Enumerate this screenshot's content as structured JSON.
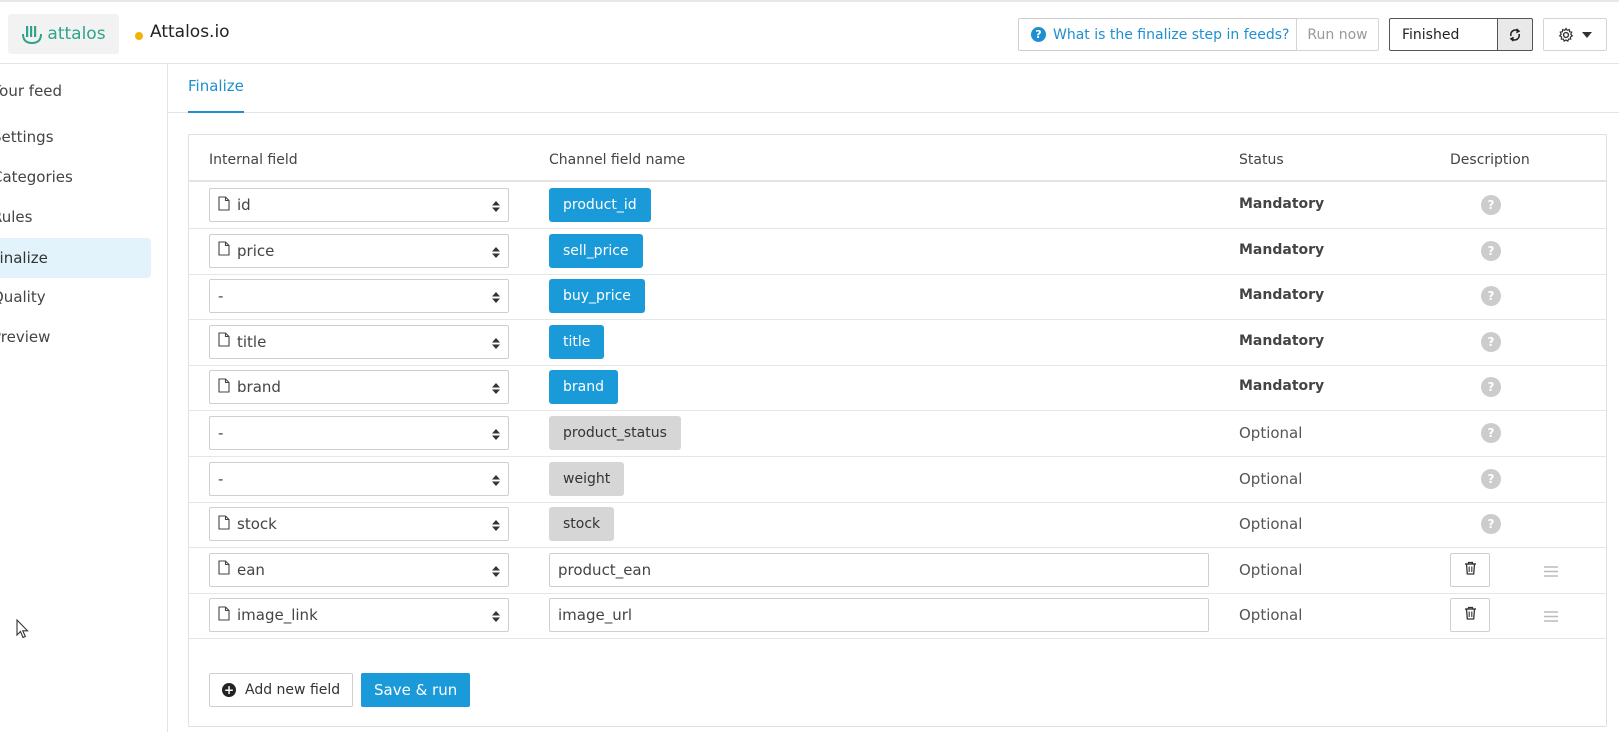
{
  "header": {
    "logo_text": "attalos",
    "project_name": "Attalos.io",
    "status_dot_color": "#f0b400",
    "help_link": "What is the finalize step in feeds?",
    "run_now": "Run now",
    "status_value": "Finished"
  },
  "sidebar": {
    "items": [
      {
        "label": "Your feed",
        "active": false
      },
      {
        "label": "Settings",
        "active": false
      },
      {
        "label": "Categories",
        "active": false
      },
      {
        "label": "Rules",
        "active": false
      },
      {
        "label": "Finalize",
        "active": true
      },
      {
        "label": "Quality",
        "active": false
      },
      {
        "label": "Preview",
        "active": false
      }
    ]
  },
  "tabs": {
    "active": "Finalize"
  },
  "table": {
    "headers": {
      "internal": "Internal field",
      "channel": "Channel field name",
      "status": "Status",
      "description": "Description"
    },
    "rows": [
      {
        "internal": "id",
        "has_icon": true,
        "channel": "product_id",
        "kind": "blue",
        "status": "Mandatory"
      },
      {
        "internal": "price",
        "has_icon": true,
        "channel": "sell_price",
        "kind": "blue",
        "status": "Mandatory"
      },
      {
        "internal": "-",
        "has_icon": false,
        "channel": "buy_price",
        "kind": "blue",
        "status": "Mandatory"
      },
      {
        "internal": "title",
        "has_icon": true,
        "channel": "title",
        "kind": "blue",
        "status": "Mandatory"
      },
      {
        "internal": "brand",
        "has_icon": true,
        "channel": "brand",
        "kind": "blue",
        "status": "Mandatory"
      },
      {
        "internal": "-",
        "has_icon": false,
        "channel": "product_status",
        "kind": "gray",
        "status": "Optional"
      },
      {
        "internal": "-",
        "has_icon": false,
        "channel": "weight",
        "kind": "gray",
        "status": "Optional"
      },
      {
        "internal": "stock",
        "has_icon": true,
        "channel": "stock",
        "kind": "gray",
        "status": "Optional"
      },
      {
        "internal": "ean",
        "has_icon": true,
        "channel": "product_ean",
        "kind": "input",
        "status": "Optional"
      },
      {
        "internal": "image_link",
        "has_icon": true,
        "channel": "image_url",
        "kind": "input",
        "status": "Optional"
      }
    ]
  },
  "actions": {
    "add_field": "Add new field",
    "save_run": "Save & run"
  },
  "colors": {
    "accent": "#1a9ad9",
    "brand_green": "#2ea58a",
    "active_bg": "#e3f3fb"
  }
}
